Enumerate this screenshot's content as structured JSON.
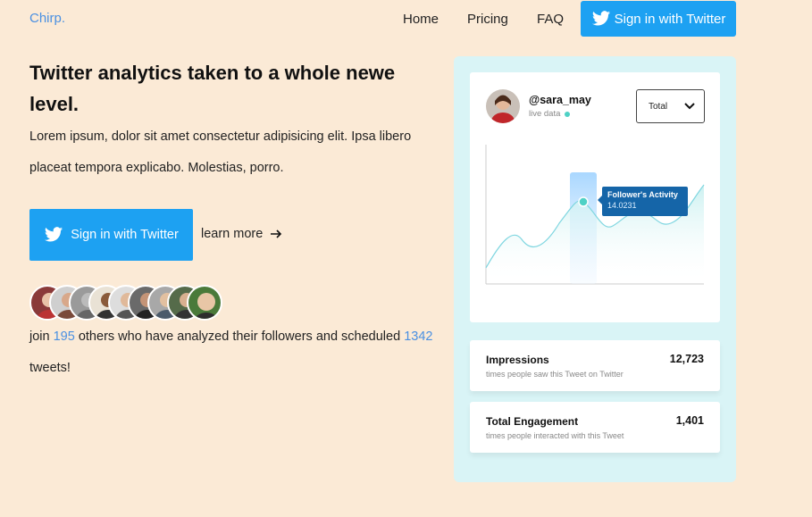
{
  "nav": {
    "logo": "Chirp.",
    "links": [
      "Home",
      "Pricing",
      "FAQ"
    ],
    "signin_label": "Sign in with Twitter"
  },
  "hero": {
    "headline": "Twitter analytics taken to a whole newe level.",
    "lead": "Lorem ipsum, dolor sit amet consectetur adipisicing elit. Ipsa libero placeat tempora explicabo. Molestias, porro.",
    "cta_label": "Sign in with Twitter",
    "learn_more": "learn more",
    "join_prefix": "join",
    "join_count": "195",
    "join_middle": "others who have analyzed their followers and scheduled",
    "tweet_count": "1342",
    "join_suffix": "tweets!"
  },
  "avatars": [
    "avatar-1",
    "avatar-2",
    "avatar-3",
    "avatar-4",
    "avatar-5",
    "avatar-6",
    "avatar-7",
    "avatar-8",
    "avatar-9"
  ],
  "profile": {
    "handle": "@sara_may",
    "status": "live data",
    "select_value": "Total"
  },
  "chart_data": {
    "type": "line",
    "tooltip_title": "Follower's Activity",
    "tooltip_value": "14.0231"
  },
  "stats": [
    {
      "title": "Impressions",
      "subtitle": "times people saw this Tweet on Twitter",
      "value": "12,723"
    },
    {
      "title": "Total Engagement",
      "subtitle": "times people interacted with this Tweet",
      "value": "1,401"
    }
  ],
  "colors": {
    "background": "#fbead6",
    "accent": "#1da1f2",
    "panel": "#d9f4f6",
    "link": "#4a90e2"
  }
}
